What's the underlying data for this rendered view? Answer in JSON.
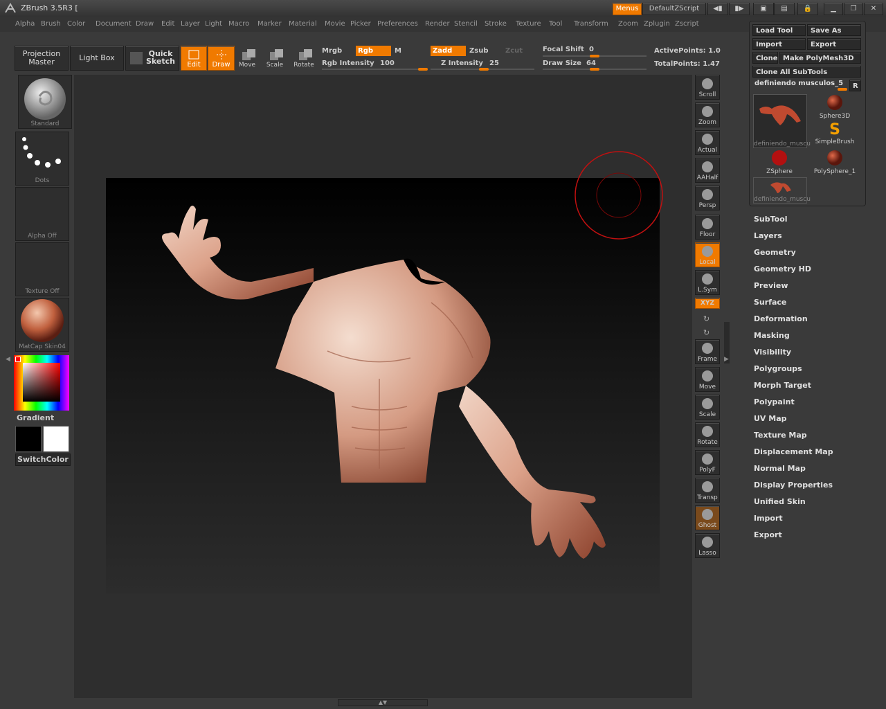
{
  "window": {
    "title": "ZBrush 3.5R3 [",
    "menus_label": "Menus",
    "script": "DefaultZScript"
  },
  "menubar": [
    "Alpha",
    "Brush",
    "Color",
    "Document",
    "Draw",
    "Edit",
    "Layer",
    "Light",
    "Macro",
    "Marker",
    "Material",
    "Movie",
    "Picker",
    "Preferences",
    "Render",
    "Stencil",
    "Stroke",
    "Texture",
    "Tool",
    "Transform",
    "Zoom",
    "Zplugin",
    "Zscript"
  ],
  "toolbar": {
    "projection_master": "Projection Master",
    "light_box": "Light Box",
    "quick_sketch": "Quick Sketch",
    "edit": "Edit",
    "draw": "Draw",
    "move": "Move",
    "scale": "Scale",
    "rotate": "Rotate",
    "mrgb": "Mrgb",
    "rgb": "Rgb",
    "m": "M",
    "zadd": "Zadd",
    "zsub": "Zsub",
    "zcut": "Zcut",
    "rgb_intensity_label": "Rgb Intensity",
    "rgb_intensity": "100",
    "z_intensity_label": "Z Intensity",
    "z_intensity": "25",
    "focal_shift_label": "Focal Shift",
    "focal_shift": "0",
    "draw_size_label": "Draw Size",
    "draw_size": "64",
    "active_points": "ActivePoints: 1.0",
    "total_points": "TotalPoints: 1.47"
  },
  "left": {
    "brush": "Standard",
    "stroke": "Dots",
    "alpha": "Alpha  Off",
    "texture": "Texture  Off",
    "material": "MatCap  Skin04",
    "gradient": "Gradient",
    "switchcolor": "SwitchColor"
  },
  "shelf": [
    "Scroll",
    "Zoom",
    "Actual",
    "AAHalf",
    "Persp",
    "Floor",
    "Local",
    "L.Sym",
    "XYZ",
    "Frame",
    "Move",
    "Scale",
    "Rotate",
    "PolyF",
    "Transp",
    "Ghost",
    "Lasso"
  ],
  "tool": {
    "load": "Load Tool",
    "save": "Save As",
    "import": "Import",
    "export": "Export",
    "clone": "Clone",
    "make_polymesh": "Make PolyMesh3D",
    "clone_all": "Clone  All  SubTools",
    "current": "definiendo  musculos_5",
    "r": "R",
    "items": [
      "definiendo_muscu",
      "Sphere3D",
      "SimpleBrush",
      "ZSphere",
      "PolySphere_1",
      "definiendo_muscu"
    ]
  },
  "submenus": [
    "SubTool",
    "Layers",
    "Geometry",
    "Geometry HD",
    "Preview",
    "Surface",
    "Deformation",
    "Masking",
    "Visibility",
    "Polygroups",
    "Morph Target",
    "Polypaint",
    "UV Map",
    "Texture Map",
    "Displacement Map",
    "Normal Map",
    "Display Properties",
    "Unified Skin",
    "Import",
    "Export"
  ],
  "colors": {
    "accent": "#f07a00"
  }
}
